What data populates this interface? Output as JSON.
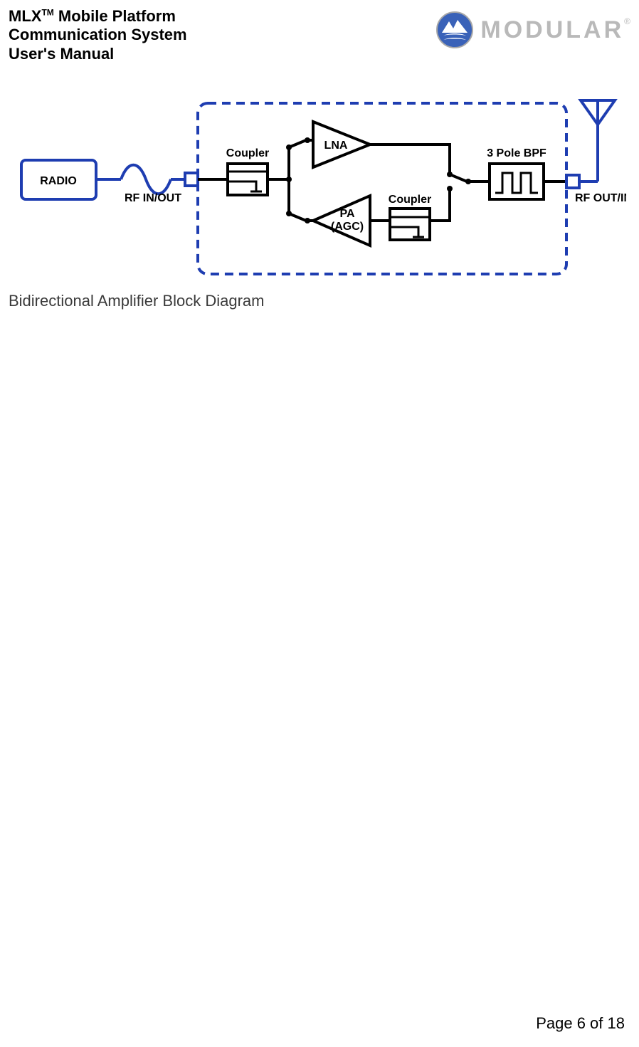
{
  "header": {
    "title_prefix": "MLX",
    "title_super": "TM",
    "title_line1_rest": " Mobile Platform",
    "title_line2": "Communication System",
    "title_line3": "User's Manual",
    "logo_word": "MODULAR",
    "logo_reg": "®"
  },
  "diagram": {
    "radio_label": "RADIO",
    "rf_in_out_left": "RF IN/OUT",
    "coupler1": "Coupler",
    "lna": "LNA",
    "pa_line1": "PA",
    "pa_line2": "(AGC)",
    "coupler2": "Coupler",
    "bpf": "3 Pole BPF",
    "rf_in_out_right": "RF OUT/IN"
  },
  "caption": "Bidirectional Amplifier Block Diagram",
  "footer": "Page 6 of 18"
}
